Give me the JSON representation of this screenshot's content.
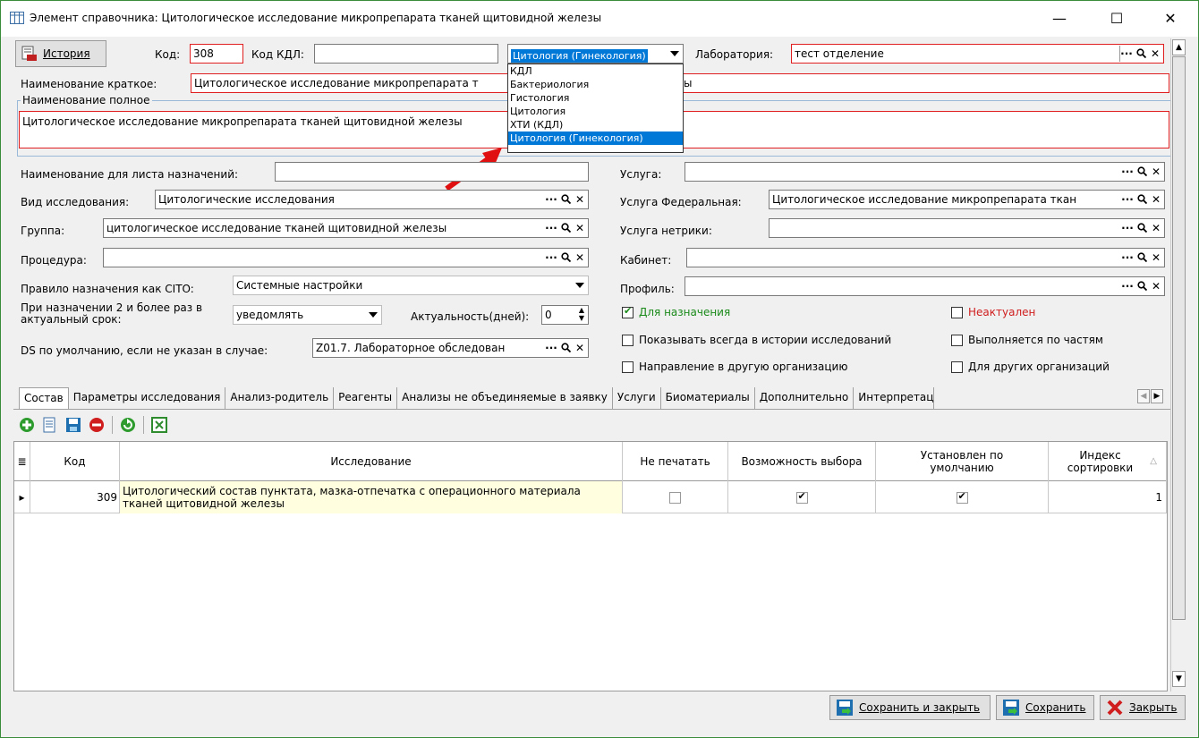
{
  "window": {
    "title": "Элемент справочника: Цитологическое исследование микропрепарата тканей щитовидной железы",
    "minimize": "—",
    "maximize": "☐",
    "close": "✕"
  },
  "top": {
    "history_label": "История",
    "code_label": "Код:",
    "code_value": "308",
    "kdl_code_label": "Код КДЛ:",
    "kdl_code_value": "",
    "lab_type_value": "Цитология (Гинекология)",
    "lab_label": "Лаборатория:",
    "lab_value": "тест отделение"
  },
  "lab_type_dropdown": {
    "options": [
      "КДЛ",
      "Бактериология",
      "Гистология",
      "Цитология",
      "ХТИ (КДЛ)",
      "Цитология (Гинекология)"
    ],
    "selected_index": 5
  },
  "names": {
    "short_label": "Наименование краткое:",
    "short_value": "Цитологическое исследование микропрепарата т",
    "short_value_tail": "ы",
    "full_label": "Наименование полное",
    "full_value": "Цитологическое исследование микропрепарата тканей щитовидной железы"
  },
  "left_form": {
    "sheet_name_label": "Наименование для листа назначений:",
    "sheet_name_value": "",
    "research_type_label": "Вид исследования:",
    "research_type_value": "Цитологические исследования",
    "group_label": "Группа:",
    "group_value": "цитологическое исследование тканей щитовидной железы",
    "procedure_label": "Процедура:",
    "procedure_value": "",
    "cito_label": "Правило назначения как CITO:",
    "cito_value": "Системные настройки",
    "repeat_label": "При назначении 2 и более раз в актуальный срок:",
    "repeat_value": "уведомлять",
    "actuality_label": "Актуальность(дней):",
    "actuality_value": "0",
    "ds_label": "DS по умолчанию, если не указан в случае:",
    "ds_value": "Z01.7. Лабораторное обследован"
  },
  "right_form": {
    "service_label": "Услуга:",
    "service_value": "",
    "federal_label": "Услуга Федеральная:",
    "federal_value": "Цитологическое исследование микропрепарата ткан",
    "netrika_label": "Услуга нетрики:",
    "netrika_value": "",
    "cabinet_label": "Кабинет:",
    "cabinet_value": "",
    "profile_label": "Профиль:",
    "profile_value": ""
  },
  "checkboxes": {
    "for_assign": {
      "label": "Для назначения",
      "checked": true,
      "color": "#1a8a1a"
    },
    "obsolete": {
      "label": "Неактуален",
      "checked": false,
      "color": "#d02020"
    },
    "show_always": {
      "label": "Показывать всегда в истории исследований",
      "checked": false
    },
    "by_parts": {
      "label": "Выполняется по частям",
      "checked": false
    },
    "other_org": {
      "label": "Направление в другую организацию",
      "checked": false
    },
    "for_other_orgs": {
      "label": "Для других организаций",
      "checked": false
    }
  },
  "tabs": [
    "Состав",
    "Параметры исследования",
    "Анализ-родитель",
    "Реагенты",
    "Анализы не объединяемые в заявку",
    "Услуги",
    "Биоматериалы",
    "Дополнительно",
    "Интерпретация результата"
  ],
  "grid": {
    "headers": {
      "code": "Код",
      "research": "Исследование",
      "no_print": "Не печатать",
      "choice": "Возможность выбора",
      "default": "Установлен по умолчанию",
      "sort_index": "Индекс сортировки"
    },
    "rows": [
      {
        "code": "309",
        "research": "Цитологический состав пунктата, мазка-отпечатка с операционного материала тканей щитовидной железы",
        "no_print": false,
        "choice": true,
        "default": true,
        "sort_index": "1"
      }
    ]
  },
  "footer": {
    "save_close": "Сохранить и закрыть",
    "save": "Сохранить",
    "close": "Закрыть"
  },
  "colors": {
    "accent": "#0078d7",
    "required_border": "#e02020",
    "row_highlight": "#ffffe0",
    "arrow": "#e01010"
  }
}
